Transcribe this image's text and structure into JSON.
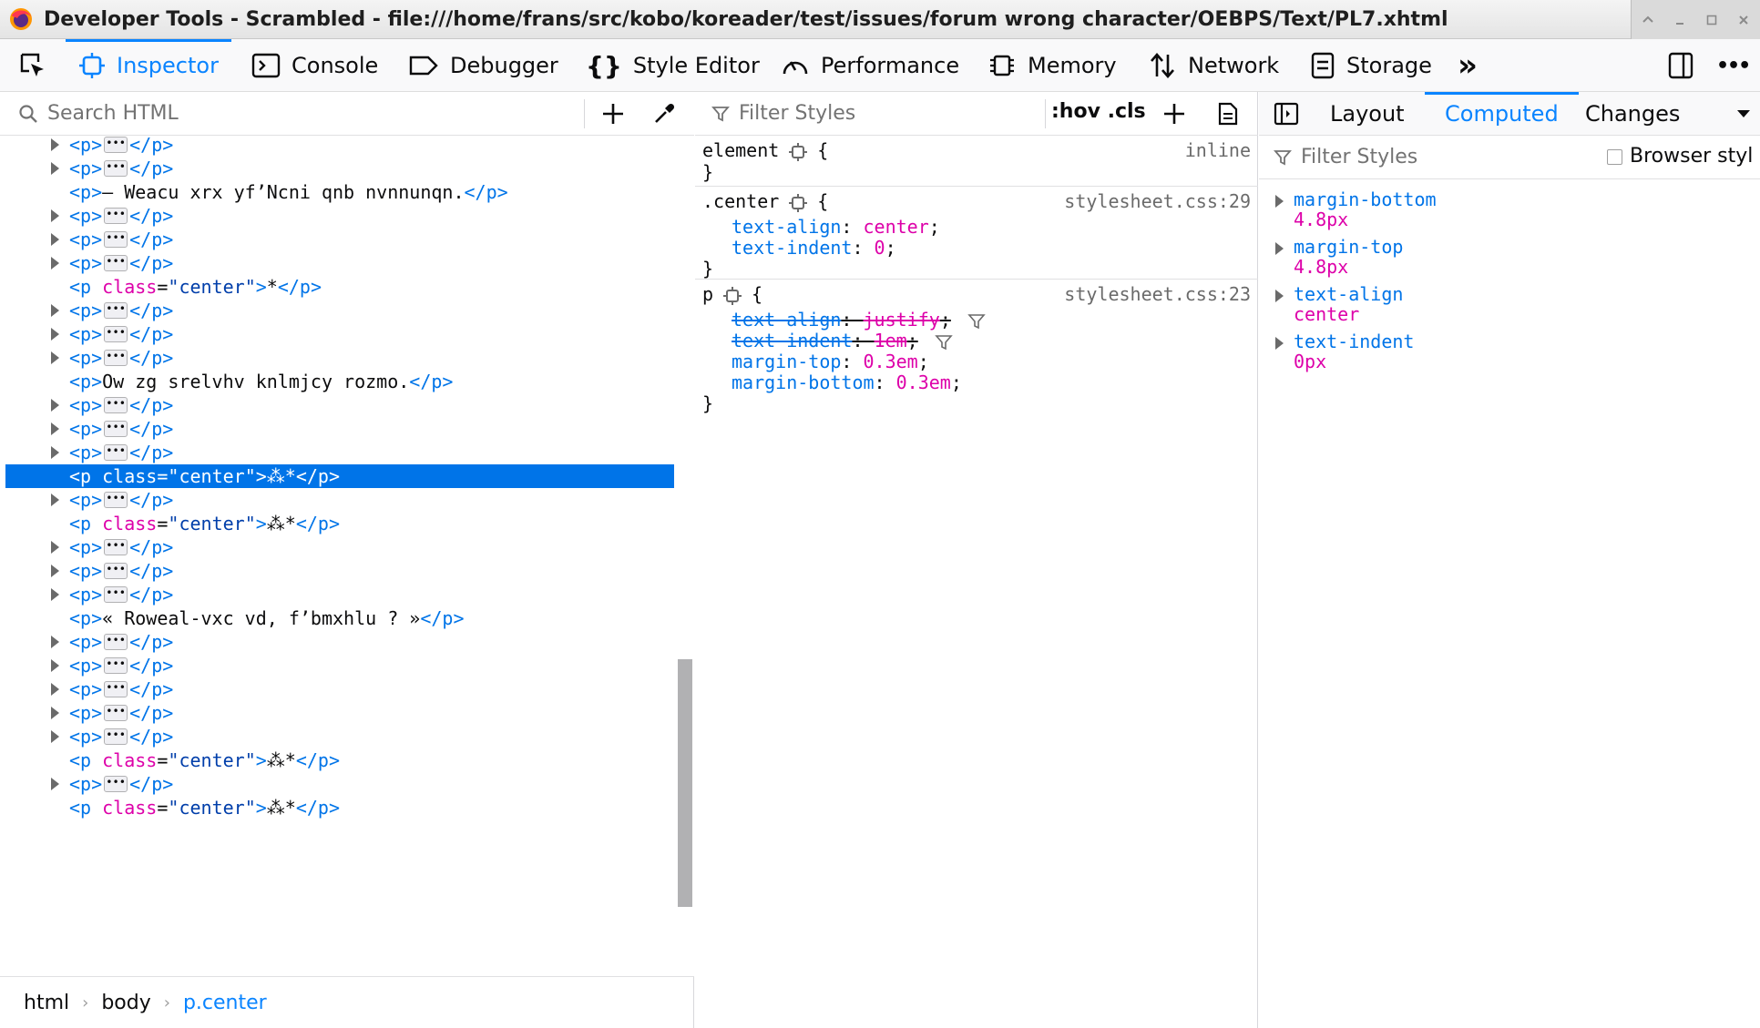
{
  "window": {
    "title": "Developer Tools - Scrambled - file:///home/frans/src/kobo/koreader/test/issues/forum wrong character/OEBPS/Text/PL7.xhtml"
  },
  "toolbar": {
    "tabs": [
      {
        "label": "Inspector",
        "icon": "inspector-icon"
      },
      {
        "label": "Console",
        "icon": "console-icon"
      },
      {
        "label": "Debugger",
        "icon": "debugger-icon"
      },
      {
        "label": "Style Editor",
        "icon": "braces-icon"
      },
      {
        "label": "Performance",
        "icon": "gauge-icon"
      },
      {
        "label": "Memory",
        "icon": "chip-icon"
      },
      {
        "label": "Network",
        "icon": "arrows-icon"
      },
      {
        "label": "Storage",
        "icon": "storage-icon"
      }
    ],
    "overflow": "»",
    "more": "•••"
  },
  "markup": {
    "search_placeholder": "Search HTML",
    "rows": [
      {
        "type": "collapsed",
        "open": "<p>",
        "close": "</p>"
      },
      {
        "type": "collapsed",
        "open": "<p>",
        "close": "</p>"
      },
      {
        "type": "text",
        "open": "<p>",
        "text": "— Weacu xrx yf’Ncni qnb nvnnunqn.",
        "close": "</p>"
      },
      {
        "type": "collapsed",
        "open": "<p>",
        "close": "</p>"
      },
      {
        "type": "collapsed",
        "open": "<p>",
        "close": "</p>"
      },
      {
        "type": "collapsed",
        "open": "<p>",
        "close": "</p>"
      },
      {
        "type": "class",
        "tag": "p",
        "attr": "class",
        "value": "\"center\"",
        "text": "*",
        "close": "</p>"
      },
      {
        "type": "collapsed",
        "open": "<p>",
        "close": "</p>"
      },
      {
        "type": "collapsed",
        "open": "<p>",
        "close": "</p>"
      },
      {
        "type": "collapsed",
        "open": "<p>",
        "close": "</p>"
      },
      {
        "type": "text",
        "open": "<p>",
        "text": "Ow zg srelvhv knlmjcy rozmo.",
        "close": "</p>"
      },
      {
        "type": "collapsed",
        "open": "<p>",
        "close": "</p>"
      },
      {
        "type": "collapsed",
        "open": "<p>",
        "close": "</p>"
      },
      {
        "type": "collapsed",
        "open": "<p>",
        "close": "</p>"
      },
      {
        "type": "class",
        "tag": "p",
        "attr": "class",
        "value": "\"center\"",
        "text": "⁂*",
        "close": "</p>",
        "selected": true
      },
      {
        "type": "collapsed",
        "open": "<p>",
        "close": "</p>"
      },
      {
        "type": "class",
        "tag": "p",
        "attr": "class",
        "value": "\"center\"",
        "text": "⁂*",
        "close": "</p>"
      },
      {
        "type": "collapsed",
        "open": "<p>",
        "close": "</p>"
      },
      {
        "type": "collapsed",
        "open": "<p>",
        "close": "</p>"
      },
      {
        "type": "collapsed",
        "open": "<p>",
        "close": "</p>"
      },
      {
        "type": "text",
        "open": "<p>",
        "text": "« Roweal-vxc vd, f’bmxhlu ? »",
        "close": "</p>"
      },
      {
        "type": "collapsed",
        "open": "<p>",
        "close": "</p>"
      },
      {
        "type": "collapsed",
        "open": "<p>",
        "close": "</p>"
      },
      {
        "type": "collapsed",
        "open": "<p>",
        "close": "</p>"
      },
      {
        "type": "collapsed",
        "open": "<p>",
        "close": "</p>"
      },
      {
        "type": "collapsed",
        "open": "<p>",
        "close": "</p>"
      },
      {
        "type": "class",
        "tag": "p",
        "attr": "class",
        "value": "\"center\"",
        "text": "⁂*",
        "close": "</p>"
      },
      {
        "type": "collapsed",
        "open": "<p>",
        "close": "</p>"
      },
      {
        "type": "class",
        "tag": "p",
        "attr": "class",
        "value": "\"center\"",
        "text": "⁂*",
        "close": "</p>"
      }
    ],
    "breadcrumbs": [
      "html",
      "body",
      "p.center"
    ]
  },
  "rules": {
    "filter_placeholder": "Filter Styles",
    "hov": ":hov",
    "cls": ".cls",
    "blocks": [
      {
        "selector": "element",
        "source": "inline",
        "declarations": []
      },
      {
        "selector": ".center",
        "source": "stylesheet.css:29",
        "declarations": [
          {
            "prop": "text-align",
            "value": "center",
            "overridden": false
          },
          {
            "prop": "text-indent",
            "value": "0",
            "overridden": false
          }
        ]
      },
      {
        "selector": "p",
        "source": "stylesheet.css:23",
        "declarations": [
          {
            "prop": "text-align",
            "value": "justify",
            "overridden": true
          },
          {
            "prop": "text-indent",
            "value": "1em",
            "overridden": true
          },
          {
            "prop": "margin-top",
            "value": "0.3em",
            "overridden": false
          },
          {
            "prop": "margin-bottom",
            "value": "0.3em",
            "overridden": false
          }
        ]
      }
    ]
  },
  "side": {
    "tabs": [
      "Layout",
      "Computed",
      "Changes"
    ],
    "active_tab": "Computed",
    "filter_placeholder": "Filter Styles",
    "browser_styles_label": "Browser styl",
    "computed": [
      {
        "name": "margin-bottom",
        "value": "4.8px"
      },
      {
        "name": "margin-top",
        "value": "4.8px"
      },
      {
        "name": "text-align",
        "value": "center"
      },
      {
        "name": "text-indent",
        "value": "0px"
      }
    ]
  },
  "colors": {
    "accent": "#0a84ff",
    "selection": "#0074e8",
    "tag": "#0074e8",
    "attr_name": "#dd00a9",
    "attr_value": "#003eaa"
  }
}
